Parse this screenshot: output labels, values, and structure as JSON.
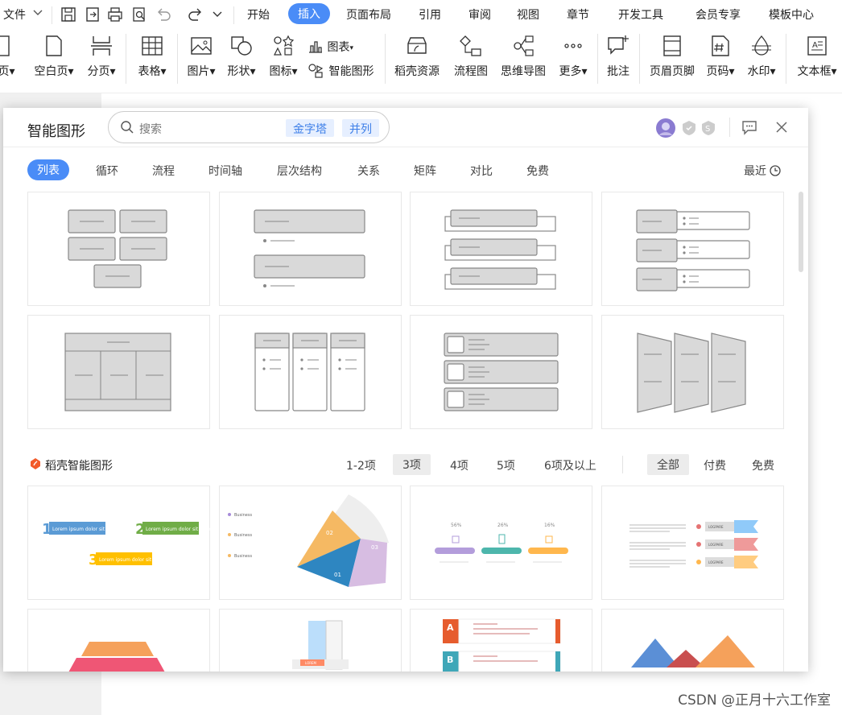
{
  "menubar": {
    "file": "文件",
    "tabs": [
      "开始",
      "插入",
      "页面布局",
      "引用",
      "审阅",
      "视图",
      "章节",
      "开发工具",
      "会员专享",
      "模板中心"
    ]
  },
  "ribbon": {
    "items": [
      "页",
      "空白页",
      "分页",
      "表格",
      "图片",
      "形状",
      "图标",
      "图表",
      "智能图形",
      "稻壳资源",
      "流程图",
      "思维导图",
      "更多",
      "批注",
      "页眉页脚",
      "页码",
      "水印",
      "文本框"
    ]
  },
  "dialog": {
    "title": "智能图形",
    "search_placeholder": "搜索",
    "search_chips": [
      "金字塔",
      "并列"
    ],
    "categories": [
      "列表",
      "循环",
      "流程",
      "时间轴",
      "层次结构",
      "关系",
      "矩阵",
      "对比",
      "免费"
    ],
    "recent": "最近",
    "section_title": "稻壳智能图形",
    "count_filters": [
      "1-2项",
      "3项",
      "4项",
      "5项",
      "6项及以上"
    ],
    "price_filters": [
      "全部",
      "付费",
      "免费"
    ]
  },
  "templates": {
    "t1": {
      "l1": "Lorem ipsum dolor sit amet",
      "n1": "1",
      "n2": "2",
      "n3": "3"
    },
    "t2": {
      "a": "Business",
      "b": "Business",
      "c": "Business",
      "s1": "01",
      "s2": "02",
      "s3": "03"
    },
    "t3": {
      "p1": "56%",
      "p2": "26%",
      "p3": "16%"
    },
    "t4": {
      "btn": "LOGPARE"
    },
    "t6": {
      "letter1": "A",
      "letter2": "B"
    },
    "t7": {
      "tag": "LOREM"
    }
  },
  "watermark": "CSDN @正月十六工作室",
  "colors": {
    "accent": "#4a8cf7",
    "card_gray": "#d9d9d9",
    "brand_orange": "#f25a29"
  }
}
